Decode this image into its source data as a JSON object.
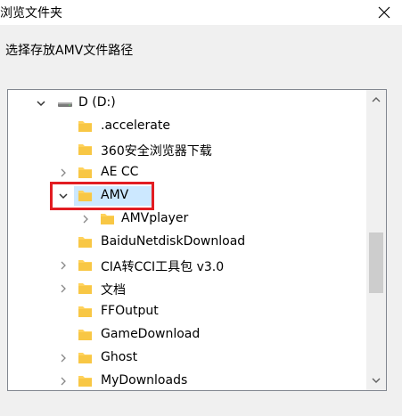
{
  "window": {
    "title": "浏览文件夹"
  },
  "description": "选择存放AMV文件路径",
  "colors": {
    "selection": "#cce8ff",
    "annotation": "#e21d22",
    "folder": "#ffd25c"
  },
  "tree": {
    "items": [
      {
        "label": "D (D:)",
        "icon": "drive-icon",
        "chevron": "down"
      },
      {
        "label": ".accelerate",
        "icon": "folder-icon",
        "chevron": "none"
      },
      {
        "label": "360安全浏览器下载",
        "icon": "folder-icon",
        "chevron": "none"
      },
      {
        "label": "AE CC",
        "icon": "folder-icon",
        "chevron": "right"
      },
      {
        "label": "AMV",
        "icon": "folder-icon",
        "chevron": "down",
        "selected": true
      },
      {
        "label": "AMVplayer",
        "icon": "folder-icon",
        "chevron": "right"
      },
      {
        "label": "BaiduNetdiskDownload",
        "icon": "folder-icon",
        "chevron": "none"
      },
      {
        "label": "CIA转CCI工具包 v3.0",
        "icon": "folder-icon",
        "chevron": "right"
      },
      {
        "label": "文档",
        "icon": "folder-icon",
        "chevron": "right"
      },
      {
        "label": "FFOutput",
        "icon": "folder-icon",
        "chevron": "none"
      },
      {
        "label": "GameDownload",
        "icon": "folder-icon",
        "chevron": "none"
      },
      {
        "label": "Ghost",
        "icon": "folder-icon",
        "chevron": "right"
      },
      {
        "label": "MyDownloads",
        "icon": "folder-icon",
        "chevron": "right"
      }
    ]
  }
}
